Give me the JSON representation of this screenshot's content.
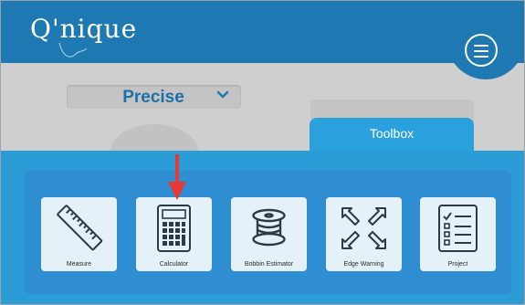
{
  "app": {
    "logo_text": "Q'nique"
  },
  "header": {
    "menu_icon": "hamburger-menu-icon"
  },
  "mode_selector": {
    "selected": "Precise",
    "chevron_icon": "chevron-down-icon"
  },
  "toolbox": {
    "tab_label": "Toolbox",
    "tools": [
      {
        "label": "Measure",
        "icon": "ruler-icon"
      },
      {
        "label": "Calculator",
        "icon": "calculator-icon"
      },
      {
        "label": "Bobbin Estimator",
        "icon": "bobbin-icon"
      },
      {
        "label": "Edge Warning",
        "icon": "expand-arrows-icon"
      },
      {
        "label": "Project",
        "icon": "checklist-icon"
      }
    ]
  },
  "annotation": {
    "arrow_color": "#e53935"
  },
  "colors": {
    "header": "#1e79b2",
    "panel": "#2b9cd6",
    "tile": "#e4f1f8",
    "icon": "#2a3a48",
    "accent_text": "#1e6fa8"
  }
}
